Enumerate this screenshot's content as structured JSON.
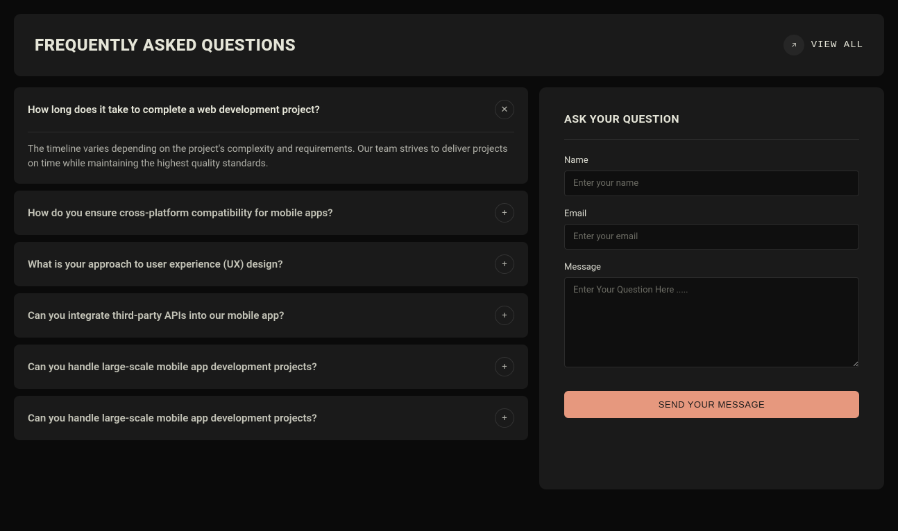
{
  "header": {
    "title": "FREQUENTLY ASKED QUESTIONS",
    "view_all_label": "VIEW ALL"
  },
  "faq": [
    {
      "question": "How long does it take to complete a web development project?",
      "answer": "The timeline varies depending on the project's complexity and requirements. Our team strives to deliver projects on time while maintaining the highest quality standards.",
      "open": true
    },
    {
      "question": "How do you ensure cross-platform compatibility for mobile apps?",
      "open": false
    },
    {
      "question": "What is your approach to user experience (UX) design?",
      "open": false
    },
    {
      "question": "Can you integrate third-party APIs into our mobile app?",
      "open": false
    },
    {
      "question": "Can you handle large-scale mobile app development projects?",
      "open": false
    },
    {
      "question": "Can you handle large-scale mobile app development projects?",
      "open": false
    }
  ],
  "icons": {
    "plus": "+",
    "close": "✕"
  },
  "form": {
    "title": "ASK YOUR QUESTION",
    "name_label": "Name",
    "name_placeholder": "Enter your name",
    "email_label": "Email",
    "email_placeholder": "Enter your email",
    "message_label": "Message",
    "message_placeholder": "Enter Your Question Here .....",
    "submit_label": "SEND YOUR MESSAGE"
  }
}
